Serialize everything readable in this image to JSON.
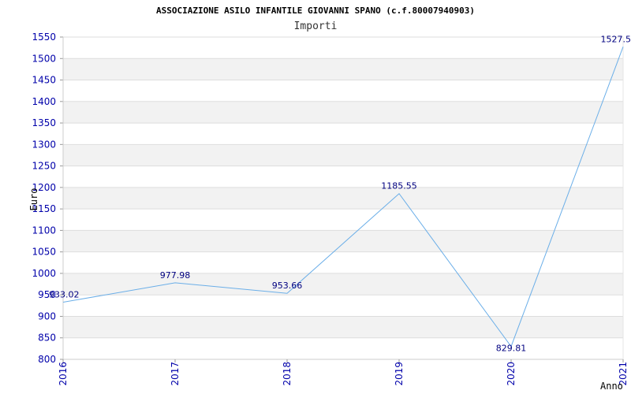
{
  "chart_data": {
    "type": "line",
    "title": "ASSOCIAZIONE ASILO INFANTILE GIOVANNI SPANO (c.f.80007940903)",
    "subtitle": "Importi",
    "xlabel": "Anno",
    "ylabel": "Euro",
    "x": [
      "2016",
      "2017",
      "2018",
      "2019",
      "2020",
      "2021"
    ],
    "values": [
      933.02,
      977.98,
      953.66,
      1185.55,
      829.81,
      1527.5
    ],
    "data_labels": [
      "933.02",
      "977.98",
      "953.66",
      "1185.55",
      "829.81",
      "1527.5"
    ],
    "ylim": [
      800,
      1550
    ],
    "yticks": [
      800,
      850,
      900,
      950,
      1000,
      1050,
      1100,
      1150,
      1200,
      1250,
      1300,
      1350,
      1400,
      1450,
      1500,
      1550
    ],
    "grid": true,
    "colors": {
      "line": "#6aaee8",
      "tick_text": "#0000aa",
      "data_label_text": "#000080",
      "band": "#f2f2f2",
      "grid": "#dddddd"
    }
  }
}
